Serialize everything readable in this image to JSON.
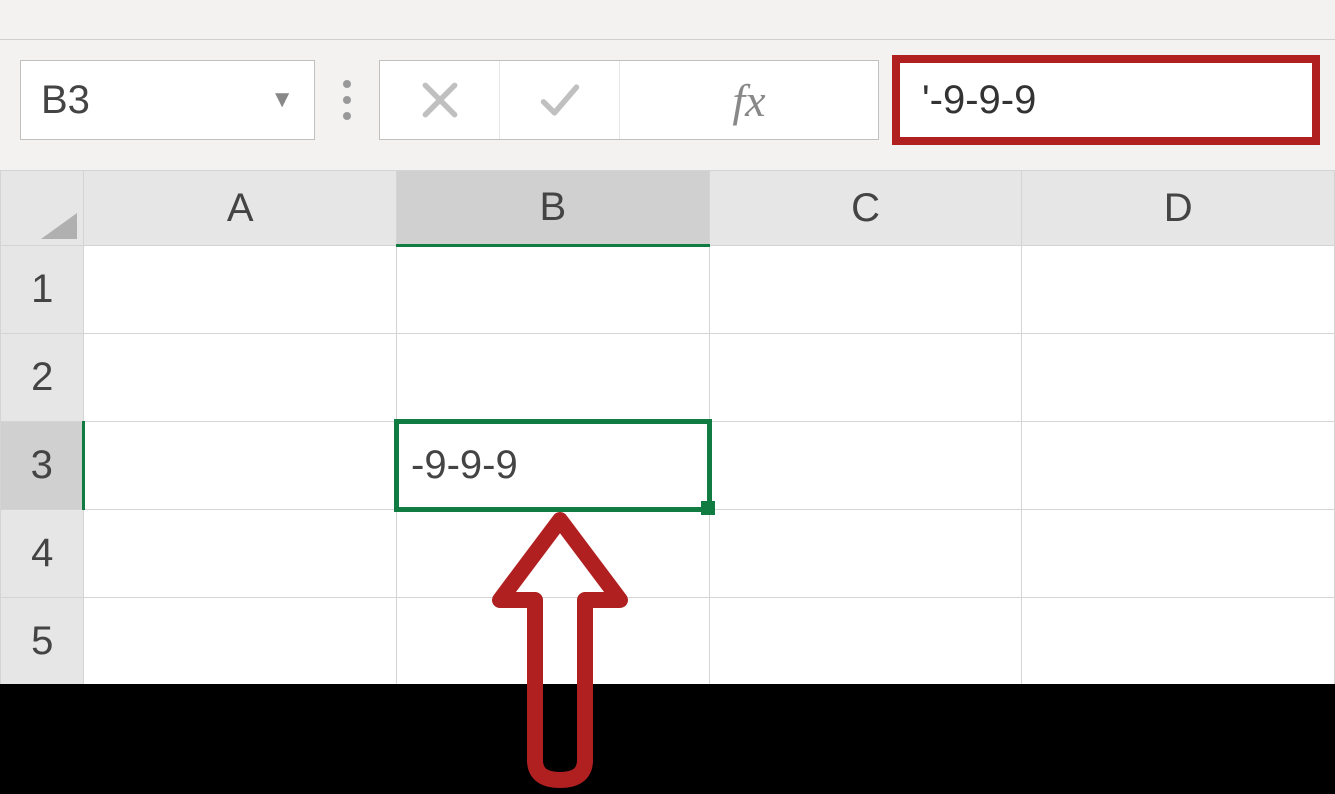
{
  "formula_bar": {
    "name_box_value": "B3",
    "fx_label": "fx",
    "formula_value": "'-9-9-9"
  },
  "columns": [
    "A",
    "B",
    "C",
    "D"
  ],
  "rows": [
    "1",
    "2",
    "3",
    "4",
    "5"
  ],
  "selected_cell": {
    "ref": "B3",
    "display_value": "-9-9-9",
    "col_index": 1,
    "row_index": 2
  },
  "icons": {
    "dropdown": "▼",
    "cancel": "✕",
    "confirm": "✓"
  }
}
